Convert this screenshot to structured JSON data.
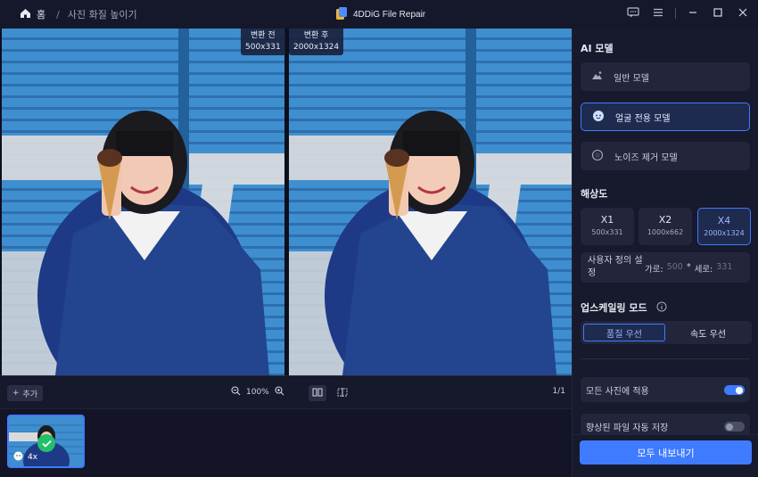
{
  "titlebar": {
    "home_label": "홈",
    "separator": "/",
    "breadcrumb": "사진 화질 높이기",
    "app_title": "4DDiG File Repair"
  },
  "preview": {
    "before": {
      "label": "변환 전",
      "size": "500x331"
    },
    "after": {
      "label": "변환 후",
      "size": "2000x1324"
    }
  },
  "toolbar": {
    "add_label": "추가",
    "zoom_value": "100%",
    "page_count": "1/1"
  },
  "thumbnail": {
    "scale_label": "4x"
  },
  "panel": {
    "ai_model_title": "AI 모델",
    "models": [
      {
        "label": "일반 모델",
        "icon": "mountain-icon",
        "selected": false
      },
      {
        "label": "얼굴 전용 모델",
        "icon": "face-icon",
        "selected": true
      },
      {
        "label": "노이즈 제거 모델",
        "icon": "denoise-icon",
        "selected": false
      }
    ],
    "resolution_title": "해상도",
    "resolutions": [
      {
        "label": "X1",
        "size": "500x331",
        "selected": false
      },
      {
        "label": "X2",
        "size": "1000x662",
        "selected": false
      },
      {
        "label": "X4",
        "size": "2000x1324",
        "selected": true
      }
    ],
    "custom": {
      "label": "사용자 정의 설정",
      "width_label": "가로:",
      "width_value": "500",
      "times": "*",
      "height_label": "세로:",
      "height_value": "331"
    },
    "upscale_mode_title": "업스케일링 모드",
    "modes": [
      {
        "label": "품질 우선",
        "selected": true
      },
      {
        "label": "속도 우선",
        "selected": false
      }
    ],
    "apply_all": {
      "label": "모든 사진에 적용",
      "on": true
    },
    "auto_save": {
      "label": "향상된 파일 자동 저장",
      "on": false
    },
    "export_label": "모두 내보내기"
  },
  "colors": {
    "accent": "#3f7bff",
    "background": "#15172a",
    "panel": "#17192c",
    "success": "#22c06b"
  }
}
